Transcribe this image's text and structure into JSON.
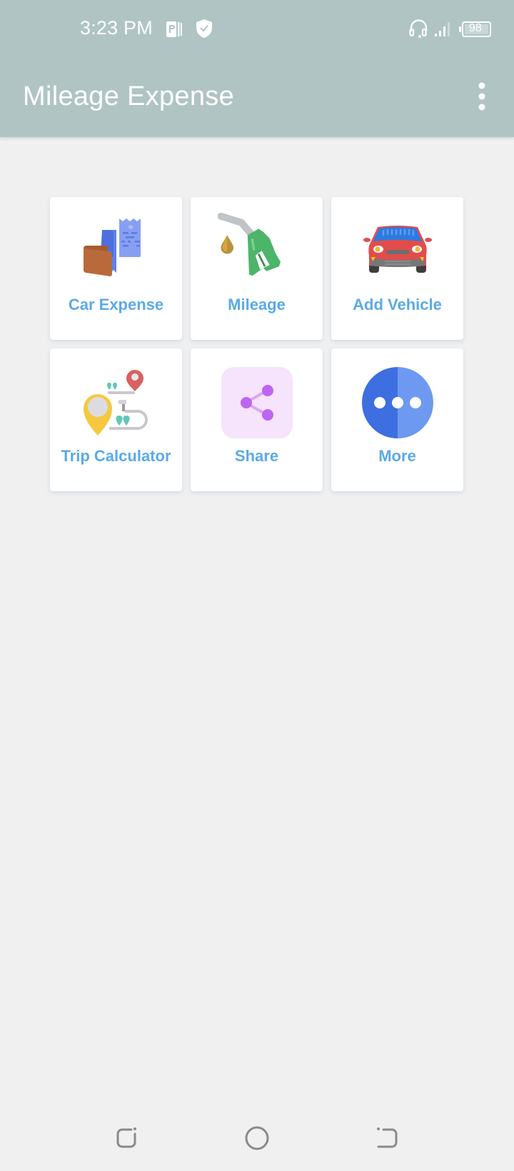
{
  "status_bar": {
    "time": "3:23 PM",
    "battery_level": "98",
    "icons": [
      "parking-app-icon",
      "shield-check-icon",
      "headset-icon",
      "signal-icon",
      "battery-icon"
    ]
  },
  "app_bar": {
    "title": "Mileage Expense",
    "overflow_icon": "more-vertical-icon"
  },
  "colors": {
    "app_bar": "#b0c4c4",
    "background": "#f0f0f0",
    "tile_label": "#5aaae8"
  },
  "menu": {
    "tiles": [
      {
        "label": "Car Expense",
        "icon": "wallet-receipt-icon"
      },
      {
        "label": "Mileage",
        "icon": "fuel-nozzle-icon"
      },
      {
        "label": "Add Vehicle",
        "icon": "car-icon"
      },
      {
        "label": "Trip Calculator",
        "icon": "route-pins-icon"
      },
      {
        "label": "Share",
        "icon": "share-icon"
      },
      {
        "label": "More",
        "icon": "more-horizontal-icon"
      }
    ]
  },
  "nav_bar": {
    "buttons": [
      "recents",
      "home",
      "back"
    ]
  }
}
